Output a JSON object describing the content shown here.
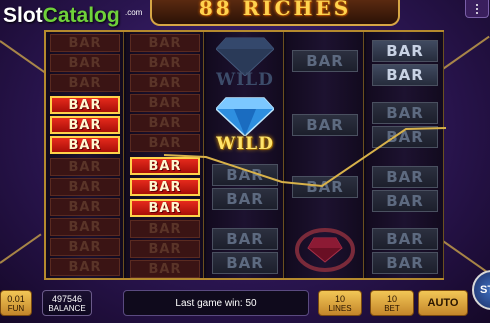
{
  "logo": {
    "slot": "Slot",
    "catalog": "Catalog",
    "com": ".com"
  },
  "title": "88 RICHES",
  "menu_icon": "three-dots-vertical",
  "reels": {
    "bar_label": "BAR",
    "wild_label": "WILD",
    "colors": {
      "winning_bar": "#d81e14",
      "payline": "#d8b24a",
      "frame": "#b58a2e"
    }
  },
  "bottom": {
    "coin": {
      "value": "0.01",
      "label": "FUN"
    },
    "balance": {
      "value": "497546",
      "label": "BALANCE"
    },
    "message": "Last game win: 50",
    "lines": {
      "value": "10",
      "label": "LINES"
    },
    "bet": {
      "value": "10",
      "label": "BET"
    },
    "auto_label": "AUTO",
    "spin_label": "ST"
  }
}
